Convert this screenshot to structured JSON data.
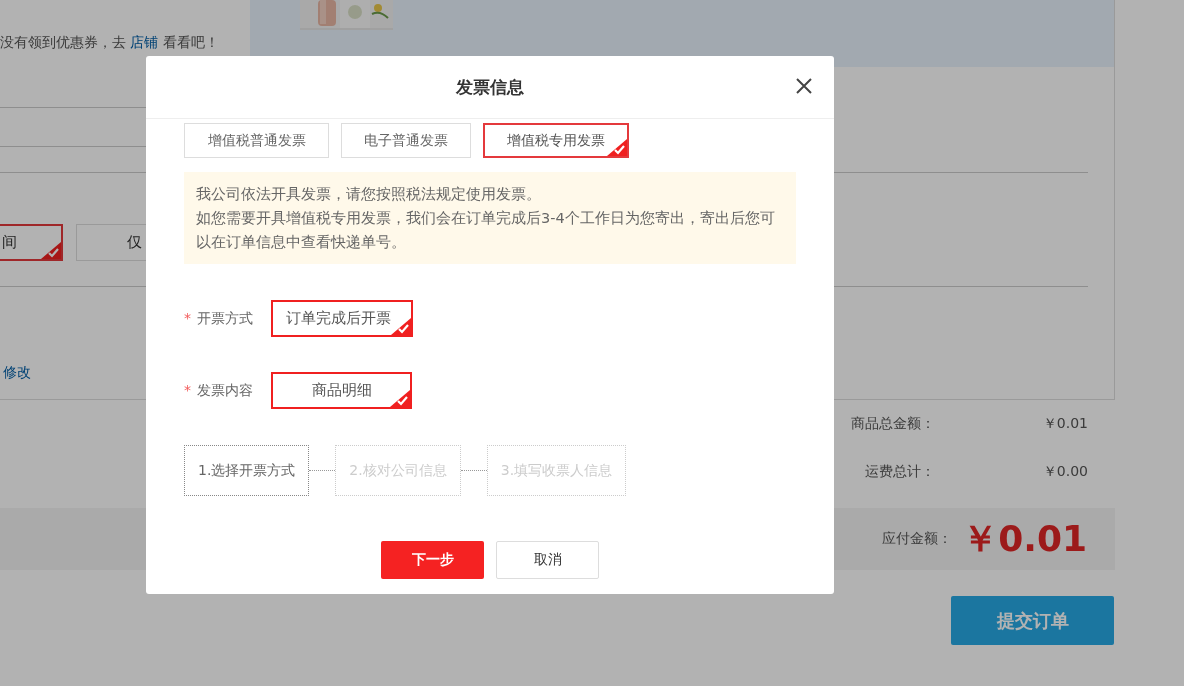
{
  "page": {
    "coupon_note": {
      "text": "没有领到优惠券，去 ",
      "link": "店铺",
      "suffix": " 看看吧！"
    },
    "options": [
      {
        "label": "间",
        "selected": true
      },
      {
        "label": "仅",
        "selected": false
      }
    ],
    "edit_link": "修改",
    "summary": [
      {
        "label": "商品总金额：",
        "value": "￥0.01"
      },
      {
        "label": "运费总计：",
        "value": "￥0.00"
      }
    ],
    "payable": {
      "label": "应付金额：",
      "value": "￥0.01"
    },
    "submit_button": "提交订单"
  },
  "dialog": {
    "title": "发票信息",
    "invoice_types": [
      {
        "label": "增值税普通发票",
        "selected": false
      },
      {
        "label": "电子普通发票",
        "selected": false
      },
      {
        "label": "增值税专用发票",
        "selected": true
      }
    ],
    "notice": [
      "我公司依法开具发票，请您按照税法规定使用发票。",
      "如您需要开具增值税专用发票，我们会在订单完成后3-4个工作日为您寄出，寄出后您可以在订单信息中查看快递单号。"
    ],
    "fields": [
      {
        "label": "开票方式",
        "required_mark": "*",
        "options": [
          {
            "label": "订单完成后开票",
            "selected": true
          }
        ]
      },
      {
        "label": "发票内容",
        "required_mark": "*",
        "options": [
          {
            "label": "商品明细",
            "selected": true
          }
        ]
      }
    ],
    "steps": [
      {
        "label": "1.选择开票方式",
        "active": true
      },
      {
        "label": "2.核对公司信息",
        "active": false
      },
      {
        "label": "3.填写收票人信息",
        "active": false
      }
    ],
    "buttons": [
      {
        "label": "下一步",
        "kind": "primary"
      },
      {
        "label": "取消",
        "kind": "default"
      }
    ]
  }
}
